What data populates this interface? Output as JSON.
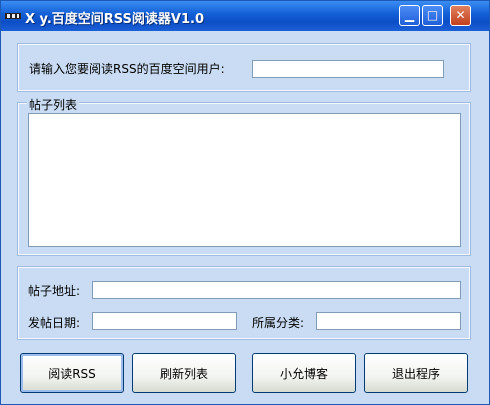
{
  "window": {
    "title": "X y.百度空间RSS阅读器V1.0",
    "minimize_glyph": "▁",
    "maximize_glyph": "□",
    "close_glyph": "✕"
  },
  "user_section": {
    "prompt_label": "请输入您要阅读RSS的百度空间用户:",
    "username_value": ""
  },
  "posts_section": {
    "legend": "帖子列表",
    "items": []
  },
  "details_section": {
    "address_label": "帖子地址:",
    "address_value": "",
    "date_label": "发帖日期:",
    "date_value": "",
    "category_label": "所属分类:",
    "category_value": ""
  },
  "buttons": {
    "read_rss": "阅读RSS",
    "refresh_list": "刷新列表",
    "blog": "小允博客",
    "exit": "退出程序"
  }
}
